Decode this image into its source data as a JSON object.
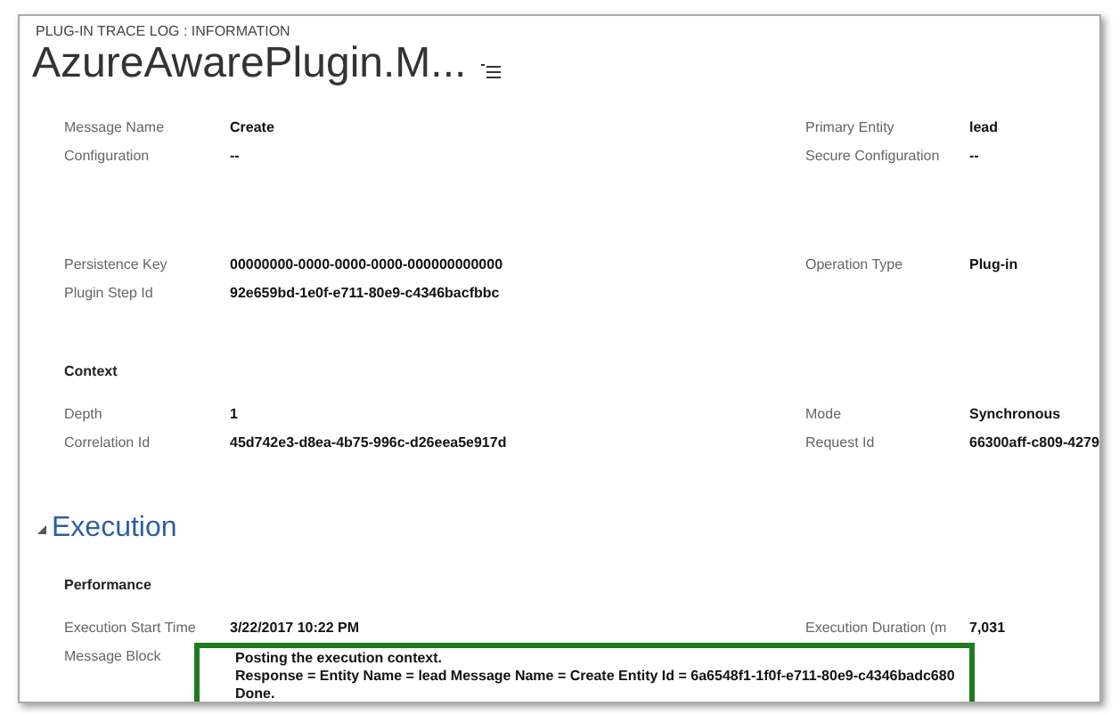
{
  "header": {
    "breadcrumb": "PLUG-IN TRACE LOG : INFORMATION",
    "title": "AzureAwarePlugin.M..."
  },
  "blocks": [
    {
      "kind": "fields",
      "rows": [
        {
          "label": "Message Name",
          "value": "Create",
          "right_label": "Primary Entity",
          "right_value": "lead"
        },
        {
          "label": "Configuration",
          "value": "--",
          "right_label": "Secure Configuration",
          "right_value": "--"
        }
      ]
    },
    {
      "kind": "fields",
      "rows": [
        {
          "label": "Persistence Key",
          "value": "00000000-0000-0000-0000-000000000000",
          "right_label": "Operation Type",
          "right_value": "Plug-in"
        },
        {
          "label": "Plugin Step Id",
          "value": "92e659bd-1e0f-e711-80e9-c4346bacfbbc"
        }
      ]
    },
    {
      "kind": "subheading",
      "text": "Context"
    },
    {
      "kind": "fields",
      "rows": [
        {
          "label": "Depth",
          "value": "1",
          "right_label": "Mode",
          "right_value": "Synchronous"
        },
        {
          "label": "Correlation Id",
          "value": "45d742e3-d8ea-4b75-996c-d26eea5e917d",
          "right_label": "Request Id",
          "right_value": "66300aff-c809-4279"
        }
      ]
    },
    {
      "kind": "section",
      "text": "Execution",
      "expanded": true
    },
    {
      "kind": "subheading",
      "text": "Performance"
    },
    {
      "kind": "fields",
      "rows": [
        {
          "label": "Execution Start Time",
          "value": "3/22/2017   10:22 PM",
          "right_label": "Execution Duration (m",
          "right_value": "7,031"
        },
        {
          "label": "Message Block",
          "lines": [
            "Posting the execution context.",
            "Response = Entity Name = lead Message Name = Create Entity Id = 6a6548f1-1f0f-e711-80e9-c4346badc680",
            "Done."
          ],
          "highlighted": true
        }
      ]
    }
  ]
}
